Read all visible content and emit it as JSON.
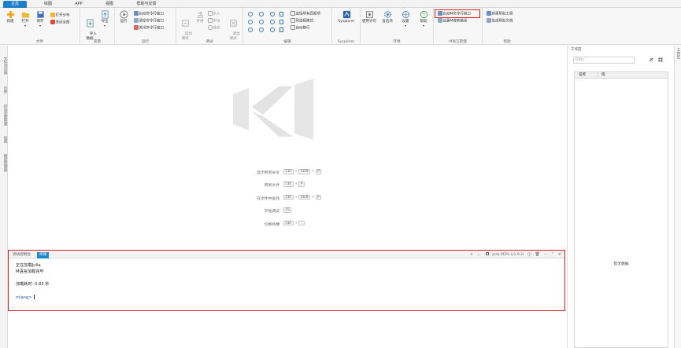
{
  "tabs": [
    "主页",
    "绘图",
    "APP",
    "视图",
    "帮助与反馈"
  ],
  "ribbon": {
    "file": {
      "label": "文件",
      "new": "新建",
      "open": "打开",
      "save": "保存",
      "open_share": "打开分布",
      "close_all": "关闭全部"
    },
    "variables": {
      "label": "变量",
      "import": "导入\n数据",
      "export": "导出"
    },
    "run": {
      "label": "运行",
      "run": "运行",
      "start_cmd": "启动命令行窗口",
      "clear_cmd": "清空命令行窗口",
      "close_cmd": "关闭命令行窗口"
    },
    "debug": {
      "label": "调试",
      "start_debug": "启动\n调试",
      "step": "步进",
      "step_in": "步入",
      "step_out_small": "步出",
      "continue": "继续",
      "step_out": "退出\n调试"
    },
    "editor": {
      "label": "编辑",
      "select_all_match": "选择所有匹配项",
      "column_select": "列选择模式",
      "auto_wrap": "自动换行"
    },
    "sysplorer": {
      "label": "Sysplorer",
      "name": "Sysplorer"
    },
    "env": {
      "label": "环境",
      "license": "使用许可",
      "preferences": "首选项",
      "settings": "设置",
      "help": "帮助"
    },
    "mworks": {
      "label": "M语言管理",
      "start_cmd": "启动M命令行窗口",
      "set_search_path": "设置M搜索路径"
    },
    "help_group": {
      "label": "帮助",
      "new_help_project": "新建帮助工程",
      "gen_help_doc": "生成帮助文档"
    }
  },
  "left_rail": [
    "文件浏览器",
    "历史",
    "环境变量管理",
    "绘图",
    "模型管理器"
  ],
  "right_rail": "工作区",
  "workspace": {
    "title": "工作区",
    "filter_placeholder": "Filter",
    "col_name": "名称",
    "col_value": "值",
    "empty": "暂无数据"
  },
  "shortcuts": [
    {
      "label": "显示所有命令",
      "keys": [
        "Ctrl",
        "Shift",
        "P"
      ]
    },
    {
      "label": "转到文件",
      "keys": [
        "Ctrl",
        "P"
      ]
    },
    {
      "label": "在文件中查找",
      "keys": [
        "Ctrl",
        "Shift",
        "F"
      ]
    },
    {
      "label": "开始调试",
      "keys": [
        "F5"
      ]
    },
    {
      "label": "切换终端",
      "keys": [
        "Ctrl",
        "`"
      ]
    }
  ],
  "console": {
    "tabs": [
      "调试控制台",
      "终端"
    ],
    "active_tab": 1,
    "toolbar": {
      "plus": "+",
      "chevron": "⌄",
      "repl": "Julia REPL (v1.9.3)"
    },
    "lines": [
      "正在加载Julia",
      "M语言加载完毕",
      "加载耗时: 0.83 秒"
    ],
    "prompt": "mlang>"
  },
  "colors": {
    "accent": "#1e7fc8",
    "highlight": "#e02020"
  }
}
